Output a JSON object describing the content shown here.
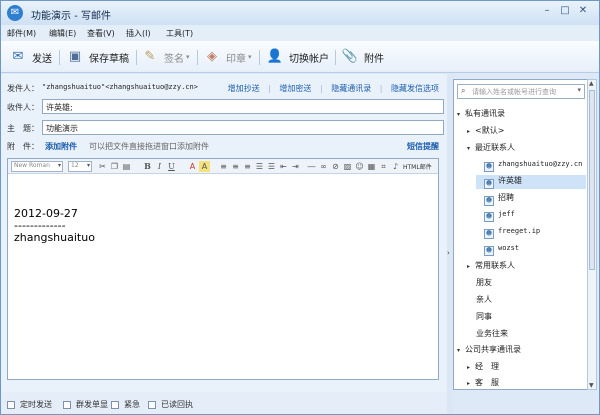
{
  "window": {
    "app_name": "功能演示",
    "title_separator": "-",
    "doc_name": "写邮件",
    "minimize_glyph": "–",
    "maximize_glyph": "□",
    "close_glyph": "✕"
  },
  "menu": [
    "邮件(M)",
    "编辑(E)",
    "查看(V)",
    "插入(I)",
    "工具(T)"
  ],
  "toolbar": {
    "send": "发送",
    "save_draft": "保存草稿",
    "signature": "签名",
    "stamp": "印章",
    "switch_account": "切换帐户",
    "attachment": "附件"
  },
  "header": {
    "sender_label": "发件人：",
    "sender_value": "\"zhangshuaituo\"<zhangshuaituo@zzy.cn>",
    "links": [
      "增加抄送",
      "增加密送",
      "隐藏通讯录",
      "隐藏发信选项"
    ],
    "to_label": "收件人：",
    "to_value": "许英雄;",
    "subject_label": "主　题：",
    "subject_value": "功能演示",
    "attach_label": "附　件：",
    "attach_link": "添加附件",
    "attach_hint": "可以把文件直接拖进窗口添加附件",
    "sms_link": "短信提醒"
  },
  "format_bar": {
    "font": "New Roman",
    "size": "12",
    "html_label": "HTML邮件"
  },
  "body": {
    "date": "2012-09-27",
    "divider": "-------------",
    "signature": "zhangshuaituo"
  },
  "options": [
    "定时发送",
    "群发单显",
    "紧急",
    "已读回执"
  ],
  "contacts": {
    "search_placeholder": "请输入姓名或帐号进行查询",
    "private_group": "私有通讯录",
    "default_group": "<默认>",
    "recent_group": "最近联系人",
    "recent": [
      "zhangshuaituo@zzy.cn",
      "许英雄",
      "招聘",
      "jeff",
      "freeget.ip",
      "wozst"
    ],
    "frequent_group": "常用联系人",
    "categories": [
      "朋友",
      "亲人",
      "同事",
      "业务往来"
    ],
    "company_group": "公司共享通讯录",
    "company_items": [
      "经　理",
      "客　服"
    ]
  },
  "colors": {
    "link": "#1d5fb0",
    "selection": "#cfe3f8",
    "border": "#8fa9c7"
  }
}
